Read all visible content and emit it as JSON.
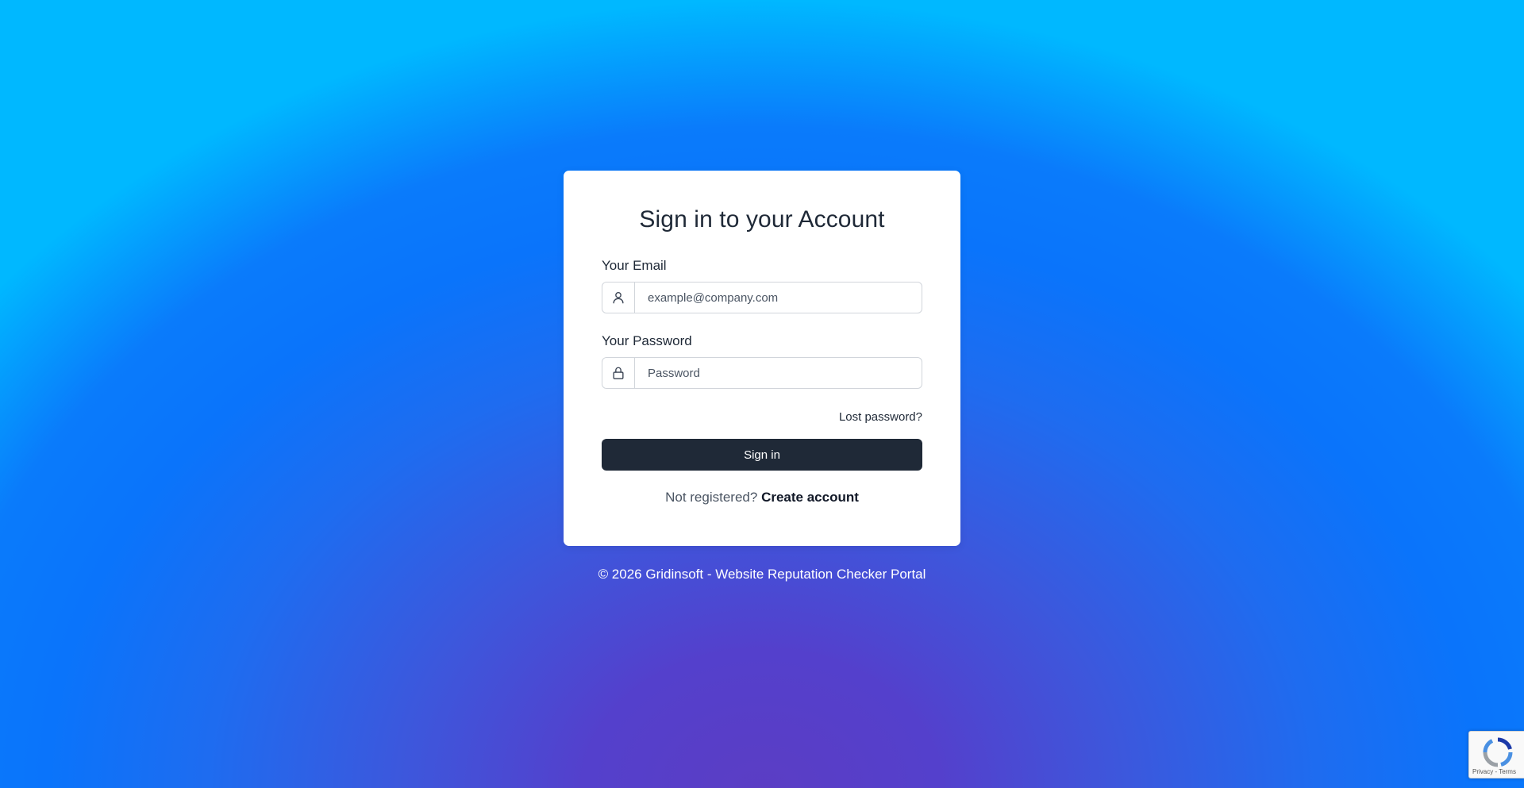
{
  "login": {
    "title": "Sign in to your Account",
    "email_label": "Your Email",
    "email_placeholder": "example@company.com",
    "password_label": "Your Password",
    "password_placeholder": "Password",
    "lost_password": "Lost password?",
    "signin_label": "Sign in",
    "not_registered": "Not registered?",
    "create_account": "Create account"
  },
  "footer": {
    "text": "© 2026 Gridinsoft - Website Reputation Checker Portal"
  },
  "recaptcha": {
    "text": "Privacy - Terms"
  },
  "icons": {
    "email": "user-icon",
    "password": "lock-icon",
    "recaptcha": "recaptcha-icon"
  },
  "colors": {
    "button_bg": "#1f2937",
    "card_bg": "#ffffff",
    "text_dark": "#1f2937"
  }
}
